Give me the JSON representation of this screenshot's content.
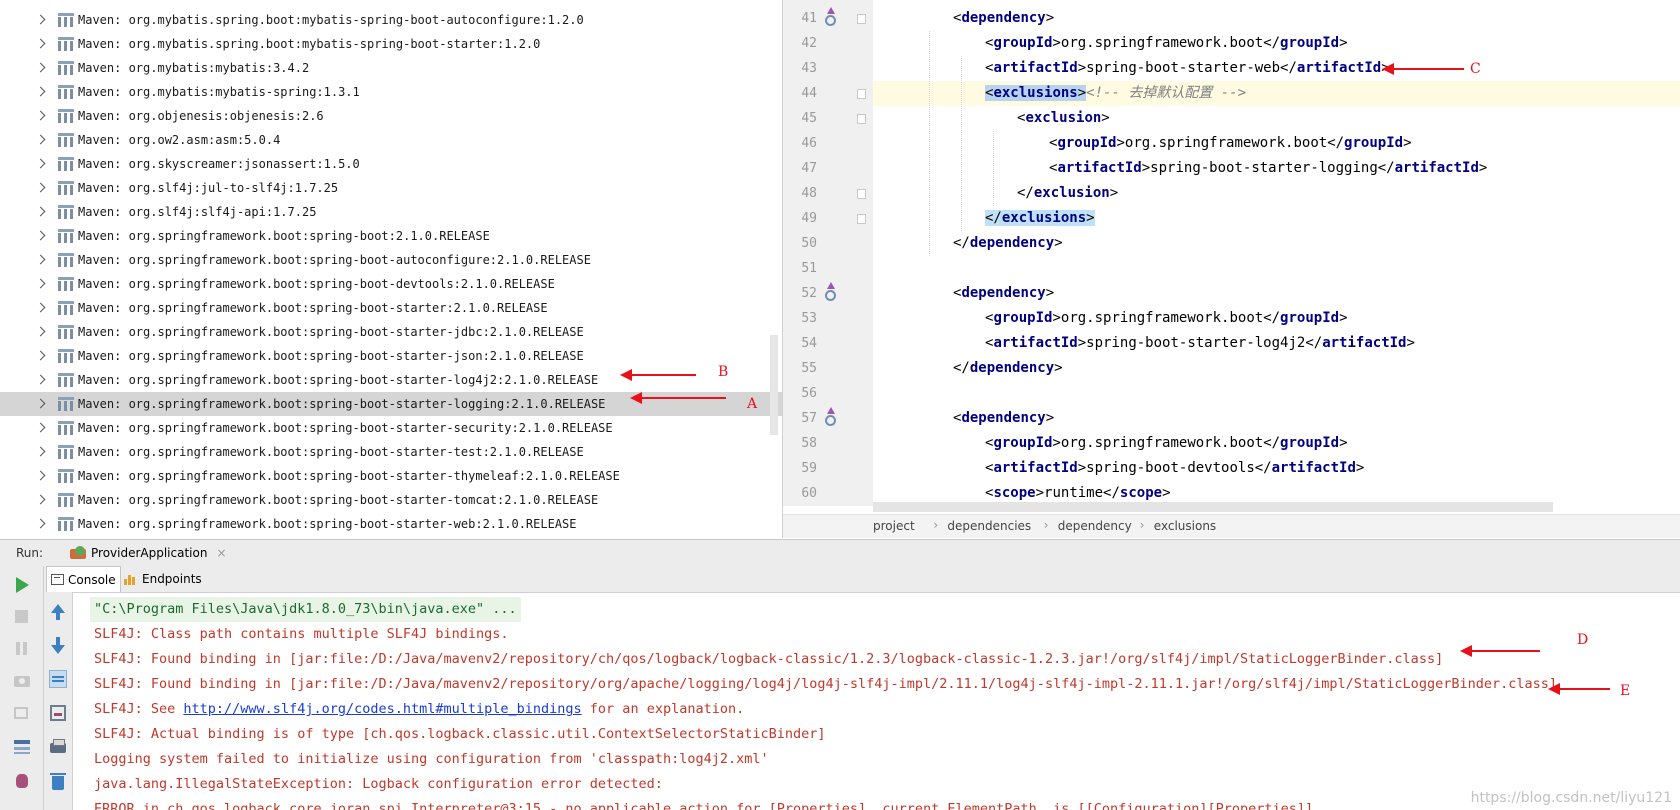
{
  "tree": {
    "items": [
      "Maven: org.mybatis.spring.boot:mybatis-spring-boot-autoconfigure:1.2.0",
      "Maven: org.mybatis.spring.boot:mybatis-spring-boot-starter:1.2.0",
      "Maven: org.mybatis:mybatis:3.4.2",
      "Maven: org.mybatis:mybatis-spring:1.3.1",
      "Maven: org.objenesis:objenesis:2.6",
      "Maven: org.ow2.asm:asm:5.0.4",
      "Maven: org.skyscreamer:jsonassert:1.5.0",
      "Maven: org.slf4j:jul-to-slf4j:1.7.25",
      "Maven: org.slf4j:slf4j-api:1.7.25",
      "Maven: org.springframework.boot:spring-boot:2.1.0.RELEASE",
      "Maven: org.springframework.boot:spring-boot-autoconfigure:2.1.0.RELEASE",
      "Maven: org.springframework.boot:spring-boot-devtools:2.1.0.RELEASE",
      "Maven: org.springframework.boot:spring-boot-starter:2.1.0.RELEASE",
      "Maven: org.springframework.boot:spring-boot-starter-jdbc:2.1.0.RELEASE",
      "Maven: org.springframework.boot:spring-boot-starter-json:2.1.0.RELEASE",
      "Maven: org.springframework.boot:spring-boot-starter-log4j2:2.1.0.RELEASE",
      "Maven: org.springframework.boot:spring-boot-starter-logging:2.1.0.RELEASE",
      "Maven: org.springframework.boot:spring-boot-starter-security:2.1.0.RELEASE",
      "Maven: org.springframework.boot:spring-boot-starter-test:2.1.0.RELEASE",
      "Maven: org.springframework.boot:spring-boot-starter-thymeleaf:2.1.0.RELEASE",
      "Maven: org.springframework.boot:spring-boot-starter-tomcat:2.1.0.RELEASE",
      "Maven: org.springframework.boot:spring-boot-starter-web:2.1.0.RELEASE"
    ],
    "selected_index": 16,
    "icon": "library-icon"
  },
  "editor": {
    "line_numbers": [
      "41",
      "42",
      "43",
      "44",
      "45",
      "46",
      "47",
      "48",
      "49",
      "50",
      "51",
      "52",
      "53",
      "54",
      "55",
      "56",
      "57",
      "58",
      "59",
      "60"
    ],
    "current_line": "44",
    "tags": {
      "dependency": "dependency",
      "groupId": "groupId",
      "artifactId": "artifactId",
      "exclusions": "exclusions",
      "exclusion": "exclusion",
      "scope": "scope"
    },
    "values": {
      "group": "org.springframework.boot",
      "web": "spring-boot-starter-web",
      "logging": "spring-boot-starter-logging",
      "log4j2": "spring-boot-starter-log4j2",
      "devtools": "spring-boot-devtools",
      "runtime": "runtime"
    },
    "comment": "<!-- 去掉默认配置 -->",
    "breadcrumbs": [
      "project",
      "dependencies",
      "dependency",
      "exclusions"
    ]
  },
  "run": {
    "label": "Run:",
    "config_name": "ProviderApplication",
    "close_glyph": "×",
    "tabs": [
      "Console",
      "Endpoints"
    ]
  },
  "console": {
    "cmd": "\"C:\\Program Files\\Java\\jdk1.8.0_73\\bin\\java.exe\" ...",
    "line1": "SLF4J: Class path contains multiple SLF4J bindings.",
    "line2": "SLF4J: Found binding in [jar:file:/D:/Java/mavenv2/repository/ch/qos/logback/logback-classic/1.2.3/logback-classic-1.2.3.jar!/org/slf4j/impl/StaticLoggerBinder.class]",
    "line3": "SLF4J: Found binding in [jar:file:/D:/Java/mavenv2/repository/org/apache/logging/log4j/log4j-slf4j-impl/2.11.1/log4j-slf4j-impl-2.11.1.jar!/org/slf4j/impl/StaticLoggerBinder.class]",
    "line4_prefix": "SLF4J: See ",
    "line4_link": "http://www.slf4j.org/codes.html#multiple_bindings",
    "line4_suffix": " for an explanation.",
    "line5": "SLF4J: Actual binding is of type [ch.qos.logback.classic.util.ContextSelectorStaticBinder]",
    "line6": "Logging system failed to initialize using configuration from 'classpath:log4j2.xml'",
    "line7": "java.lang.IllegalStateException: Logback configuration error detected:",
    "line8": "ERROR in ch.qos.logback.core.joran.spi.Interpreter@3:15 - no applicable action for [Properties], current ElementPath  is [[Configuration][Properties]]"
  },
  "annotations": {
    "a": "A",
    "b": "B",
    "c": "C",
    "d": "D",
    "e": "E",
    "color": "#e8111a"
  },
  "watermark": "https://blog.csdn.net/liyu121"
}
